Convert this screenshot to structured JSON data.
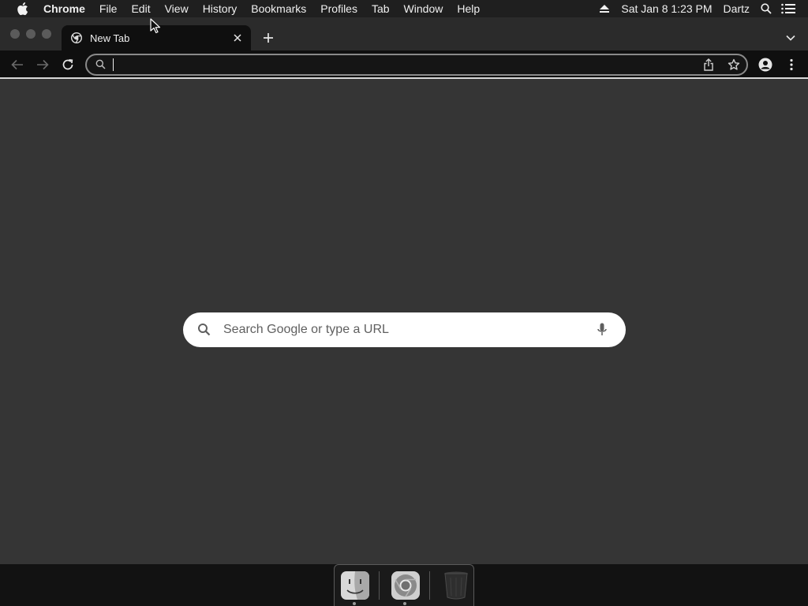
{
  "menubar": {
    "app_name": "Chrome",
    "items": [
      "File",
      "Edit",
      "View",
      "History",
      "Bookmarks",
      "Profiles",
      "Tab",
      "Window",
      "Help"
    ],
    "datetime": "Sat Jan 8  1:23 PM",
    "user": "Dartz",
    "icons": [
      "apple-icon",
      "eject-icon",
      "spotlight-search-icon",
      "notification-center-icon"
    ]
  },
  "tab": {
    "title": "New Tab",
    "favicon": "chrome-icon"
  },
  "toolbar": {
    "omnibox_value": "",
    "icons": [
      "back-arrow-icon",
      "forward-arrow-icon",
      "reload-icon",
      "search-icon",
      "share-icon",
      "star-icon",
      "profile-icon",
      "more-menu-icon"
    ]
  },
  "ntp": {
    "search_placeholder": "Search Google or type a URL"
  },
  "dock": {
    "apps": [
      "Finder",
      "Google Chrome",
      "Trash"
    ]
  },
  "colors": {
    "page_background": "#353535",
    "toolbar_background": "#0f0f0f",
    "menubar_background": "#1f1f1f",
    "search_box": "#ffffff"
  }
}
